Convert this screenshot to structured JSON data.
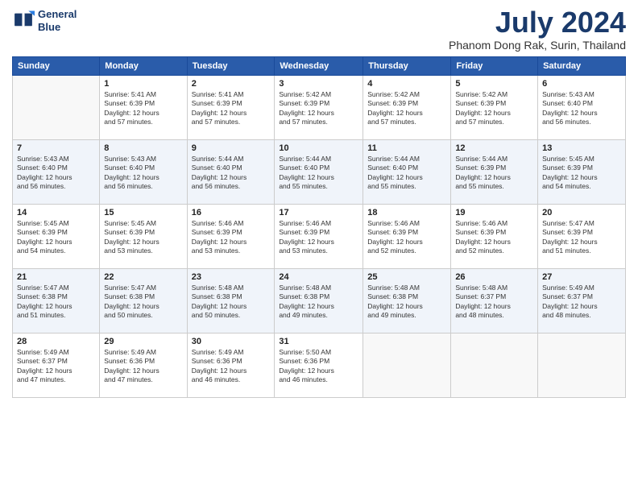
{
  "logo": {
    "line1": "General",
    "line2": "Blue"
  },
  "title": "July 2024",
  "location": "Phanom Dong Rak, Surin, Thailand",
  "days_of_week": [
    "Sunday",
    "Monday",
    "Tuesday",
    "Wednesday",
    "Thursday",
    "Friday",
    "Saturday"
  ],
  "weeks": [
    [
      {
        "day": "",
        "info": ""
      },
      {
        "day": "1",
        "info": "Sunrise: 5:41 AM\nSunset: 6:39 PM\nDaylight: 12 hours\nand 57 minutes."
      },
      {
        "day": "2",
        "info": "Sunrise: 5:41 AM\nSunset: 6:39 PM\nDaylight: 12 hours\nand 57 minutes."
      },
      {
        "day": "3",
        "info": "Sunrise: 5:42 AM\nSunset: 6:39 PM\nDaylight: 12 hours\nand 57 minutes."
      },
      {
        "day": "4",
        "info": "Sunrise: 5:42 AM\nSunset: 6:39 PM\nDaylight: 12 hours\nand 57 minutes."
      },
      {
        "day": "5",
        "info": "Sunrise: 5:42 AM\nSunset: 6:39 PM\nDaylight: 12 hours\nand 57 minutes."
      },
      {
        "day": "6",
        "info": "Sunrise: 5:43 AM\nSunset: 6:40 PM\nDaylight: 12 hours\nand 56 minutes."
      }
    ],
    [
      {
        "day": "7",
        "info": "Sunrise: 5:43 AM\nSunset: 6:40 PM\nDaylight: 12 hours\nand 56 minutes."
      },
      {
        "day": "8",
        "info": "Sunrise: 5:43 AM\nSunset: 6:40 PM\nDaylight: 12 hours\nand 56 minutes."
      },
      {
        "day": "9",
        "info": "Sunrise: 5:44 AM\nSunset: 6:40 PM\nDaylight: 12 hours\nand 56 minutes."
      },
      {
        "day": "10",
        "info": "Sunrise: 5:44 AM\nSunset: 6:40 PM\nDaylight: 12 hours\nand 55 minutes."
      },
      {
        "day": "11",
        "info": "Sunrise: 5:44 AM\nSunset: 6:40 PM\nDaylight: 12 hours\nand 55 minutes."
      },
      {
        "day": "12",
        "info": "Sunrise: 5:44 AM\nSunset: 6:39 PM\nDaylight: 12 hours\nand 55 minutes."
      },
      {
        "day": "13",
        "info": "Sunrise: 5:45 AM\nSunset: 6:39 PM\nDaylight: 12 hours\nand 54 minutes."
      }
    ],
    [
      {
        "day": "14",
        "info": "Sunrise: 5:45 AM\nSunset: 6:39 PM\nDaylight: 12 hours\nand 54 minutes."
      },
      {
        "day": "15",
        "info": "Sunrise: 5:45 AM\nSunset: 6:39 PM\nDaylight: 12 hours\nand 53 minutes."
      },
      {
        "day": "16",
        "info": "Sunrise: 5:46 AM\nSunset: 6:39 PM\nDaylight: 12 hours\nand 53 minutes."
      },
      {
        "day": "17",
        "info": "Sunrise: 5:46 AM\nSunset: 6:39 PM\nDaylight: 12 hours\nand 53 minutes."
      },
      {
        "day": "18",
        "info": "Sunrise: 5:46 AM\nSunset: 6:39 PM\nDaylight: 12 hours\nand 52 minutes."
      },
      {
        "day": "19",
        "info": "Sunrise: 5:46 AM\nSunset: 6:39 PM\nDaylight: 12 hours\nand 52 minutes."
      },
      {
        "day": "20",
        "info": "Sunrise: 5:47 AM\nSunset: 6:39 PM\nDaylight: 12 hours\nand 51 minutes."
      }
    ],
    [
      {
        "day": "21",
        "info": "Sunrise: 5:47 AM\nSunset: 6:38 PM\nDaylight: 12 hours\nand 51 minutes."
      },
      {
        "day": "22",
        "info": "Sunrise: 5:47 AM\nSunset: 6:38 PM\nDaylight: 12 hours\nand 50 minutes."
      },
      {
        "day": "23",
        "info": "Sunrise: 5:48 AM\nSunset: 6:38 PM\nDaylight: 12 hours\nand 50 minutes."
      },
      {
        "day": "24",
        "info": "Sunrise: 5:48 AM\nSunset: 6:38 PM\nDaylight: 12 hours\nand 49 minutes."
      },
      {
        "day": "25",
        "info": "Sunrise: 5:48 AM\nSunset: 6:38 PM\nDaylight: 12 hours\nand 49 minutes."
      },
      {
        "day": "26",
        "info": "Sunrise: 5:48 AM\nSunset: 6:37 PM\nDaylight: 12 hours\nand 48 minutes."
      },
      {
        "day": "27",
        "info": "Sunrise: 5:49 AM\nSunset: 6:37 PM\nDaylight: 12 hours\nand 48 minutes."
      }
    ],
    [
      {
        "day": "28",
        "info": "Sunrise: 5:49 AM\nSunset: 6:37 PM\nDaylight: 12 hours\nand 47 minutes."
      },
      {
        "day": "29",
        "info": "Sunrise: 5:49 AM\nSunset: 6:36 PM\nDaylight: 12 hours\nand 47 minutes."
      },
      {
        "day": "30",
        "info": "Sunrise: 5:49 AM\nSunset: 6:36 PM\nDaylight: 12 hours\nand 46 minutes."
      },
      {
        "day": "31",
        "info": "Sunrise: 5:50 AM\nSunset: 6:36 PM\nDaylight: 12 hours\nand 46 minutes."
      },
      {
        "day": "",
        "info": ""
      },
      {
        "day": "",
        "info": ""
      },
      {
        "day": "",
        "info": ""
      }
    ]
  ]
}
